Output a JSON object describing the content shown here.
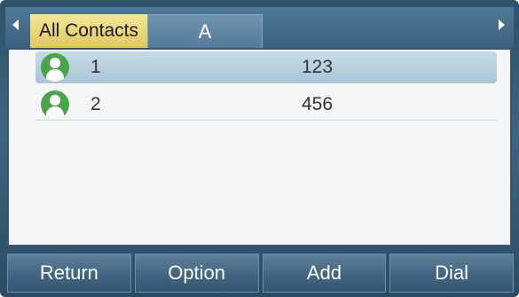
{
  "tabs": [
    {
      "label": "All Contacts",
      "selected": true
    },
    {
      "label": "A",
      "selected": false
    }
  ],
  "contacts": [
    {
      "name": "1",
      "number": "123",
      "selected": true
    },
    {
      "name": "2",
      "number": "456",
      "selected": false
    }
  ],
  "softkeys": {
    "return_label": "Return",
    "option_label": "Option",
    "add_label": "Add",
    "dial_label": "Dial"
  },
  "icons": {
    "contact": "contact-avatar-icon",
    "left_arrow": "arrow-left-icon",
    "right_arrow": "arrow-right-icon"
  },
  "colors": {
    "selected_tab": "#e8d270",
    "selected_row": "#b6cfde",
    "avatar": "#4aa44a"
  }
}
